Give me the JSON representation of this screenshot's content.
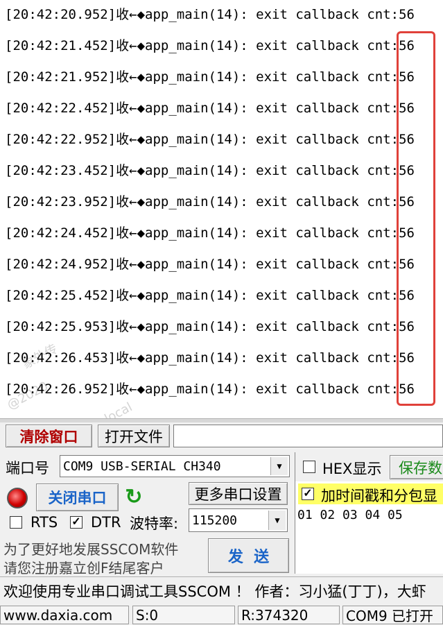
{
  "log": {
    "lines": [
      "[20:42:20.952]收←◆app_main(14): exit callback cnt:56",
      "[20:42:21.452]收←◆app_main(14): exit callback cnt:56",
      "[20:42:21.952]收←◆app_main(14): exit callback cnt:56",
      "[20:42:22.452]收←◆app_main(14): exit callback cnt:56",
      "[20:42:22.952]收←◆app_main(14): exit callback cnt:56",
      "[20:42:23.452]收←◆app_main(14): exit callback cnt:56",
      "[20:42:23.952]收←◆app_main(14): exit callback cnt:56",
      "[20:42:24.452]收←◆app_main(14): exit callback cnt:56",
      "[20:42:24.952]收←◆app_main(14): exit callback cnt:56",
      "[20:42:25.452]收←◆app_main(14): exit callback cnt:56",
      "[20:42:25.953]收←◆app_main(14): exit callback cnt:56",
      "[20:42:26.453]收←◆app_main(14): exit callback cnt:56",
      "[20:42:26.952]收←◆app_main(14): exit callback cnt:56"
    ],
    "watermark_1": "象外传",
    "watermark_2": "@2020",
    "watermark_3": "local",
    "highlight_color": "#e0413a"
  },
  "toolbar": {
    "clear_label": "清除窗口",
    "open_file_label": "打开文件"
  },
  "port": {
    "port_label": "端口号",
    "port_value": "COM9 USB-SERIAL CH340",
    "close_port_label": "关闭串口",
    "more_settings_label": "更多串口设置",
    "rts_label": "RTS",
    "dtr_label": "DTR",
    "baud_label": "波特率:",
    "baud_value": "115200",
    "promo_line1": "为了更好地发展SSCOM软件",
    "promo_line2": "请您注册嘉立创F结尾客户",
    "send_label": "发  送"
  },
  "right_panel": {
    "hex_label": "HEX显示",
    "save_label": "保存数",
    "timestamp_label": "加时间戳和分包显",
    "send_text": "01 02 03 04 05"
  },
  "marquee": "欢迎使用专业串口调试工具SSCOM ！  作者：习小猛(丁丁)，大虾",
  "statusbar": {
    "website": "www.daxia.com",
    "sent": "S:0",
    "received": "R:374320",
    "port_status": "COM9 已打开"
  }
}
